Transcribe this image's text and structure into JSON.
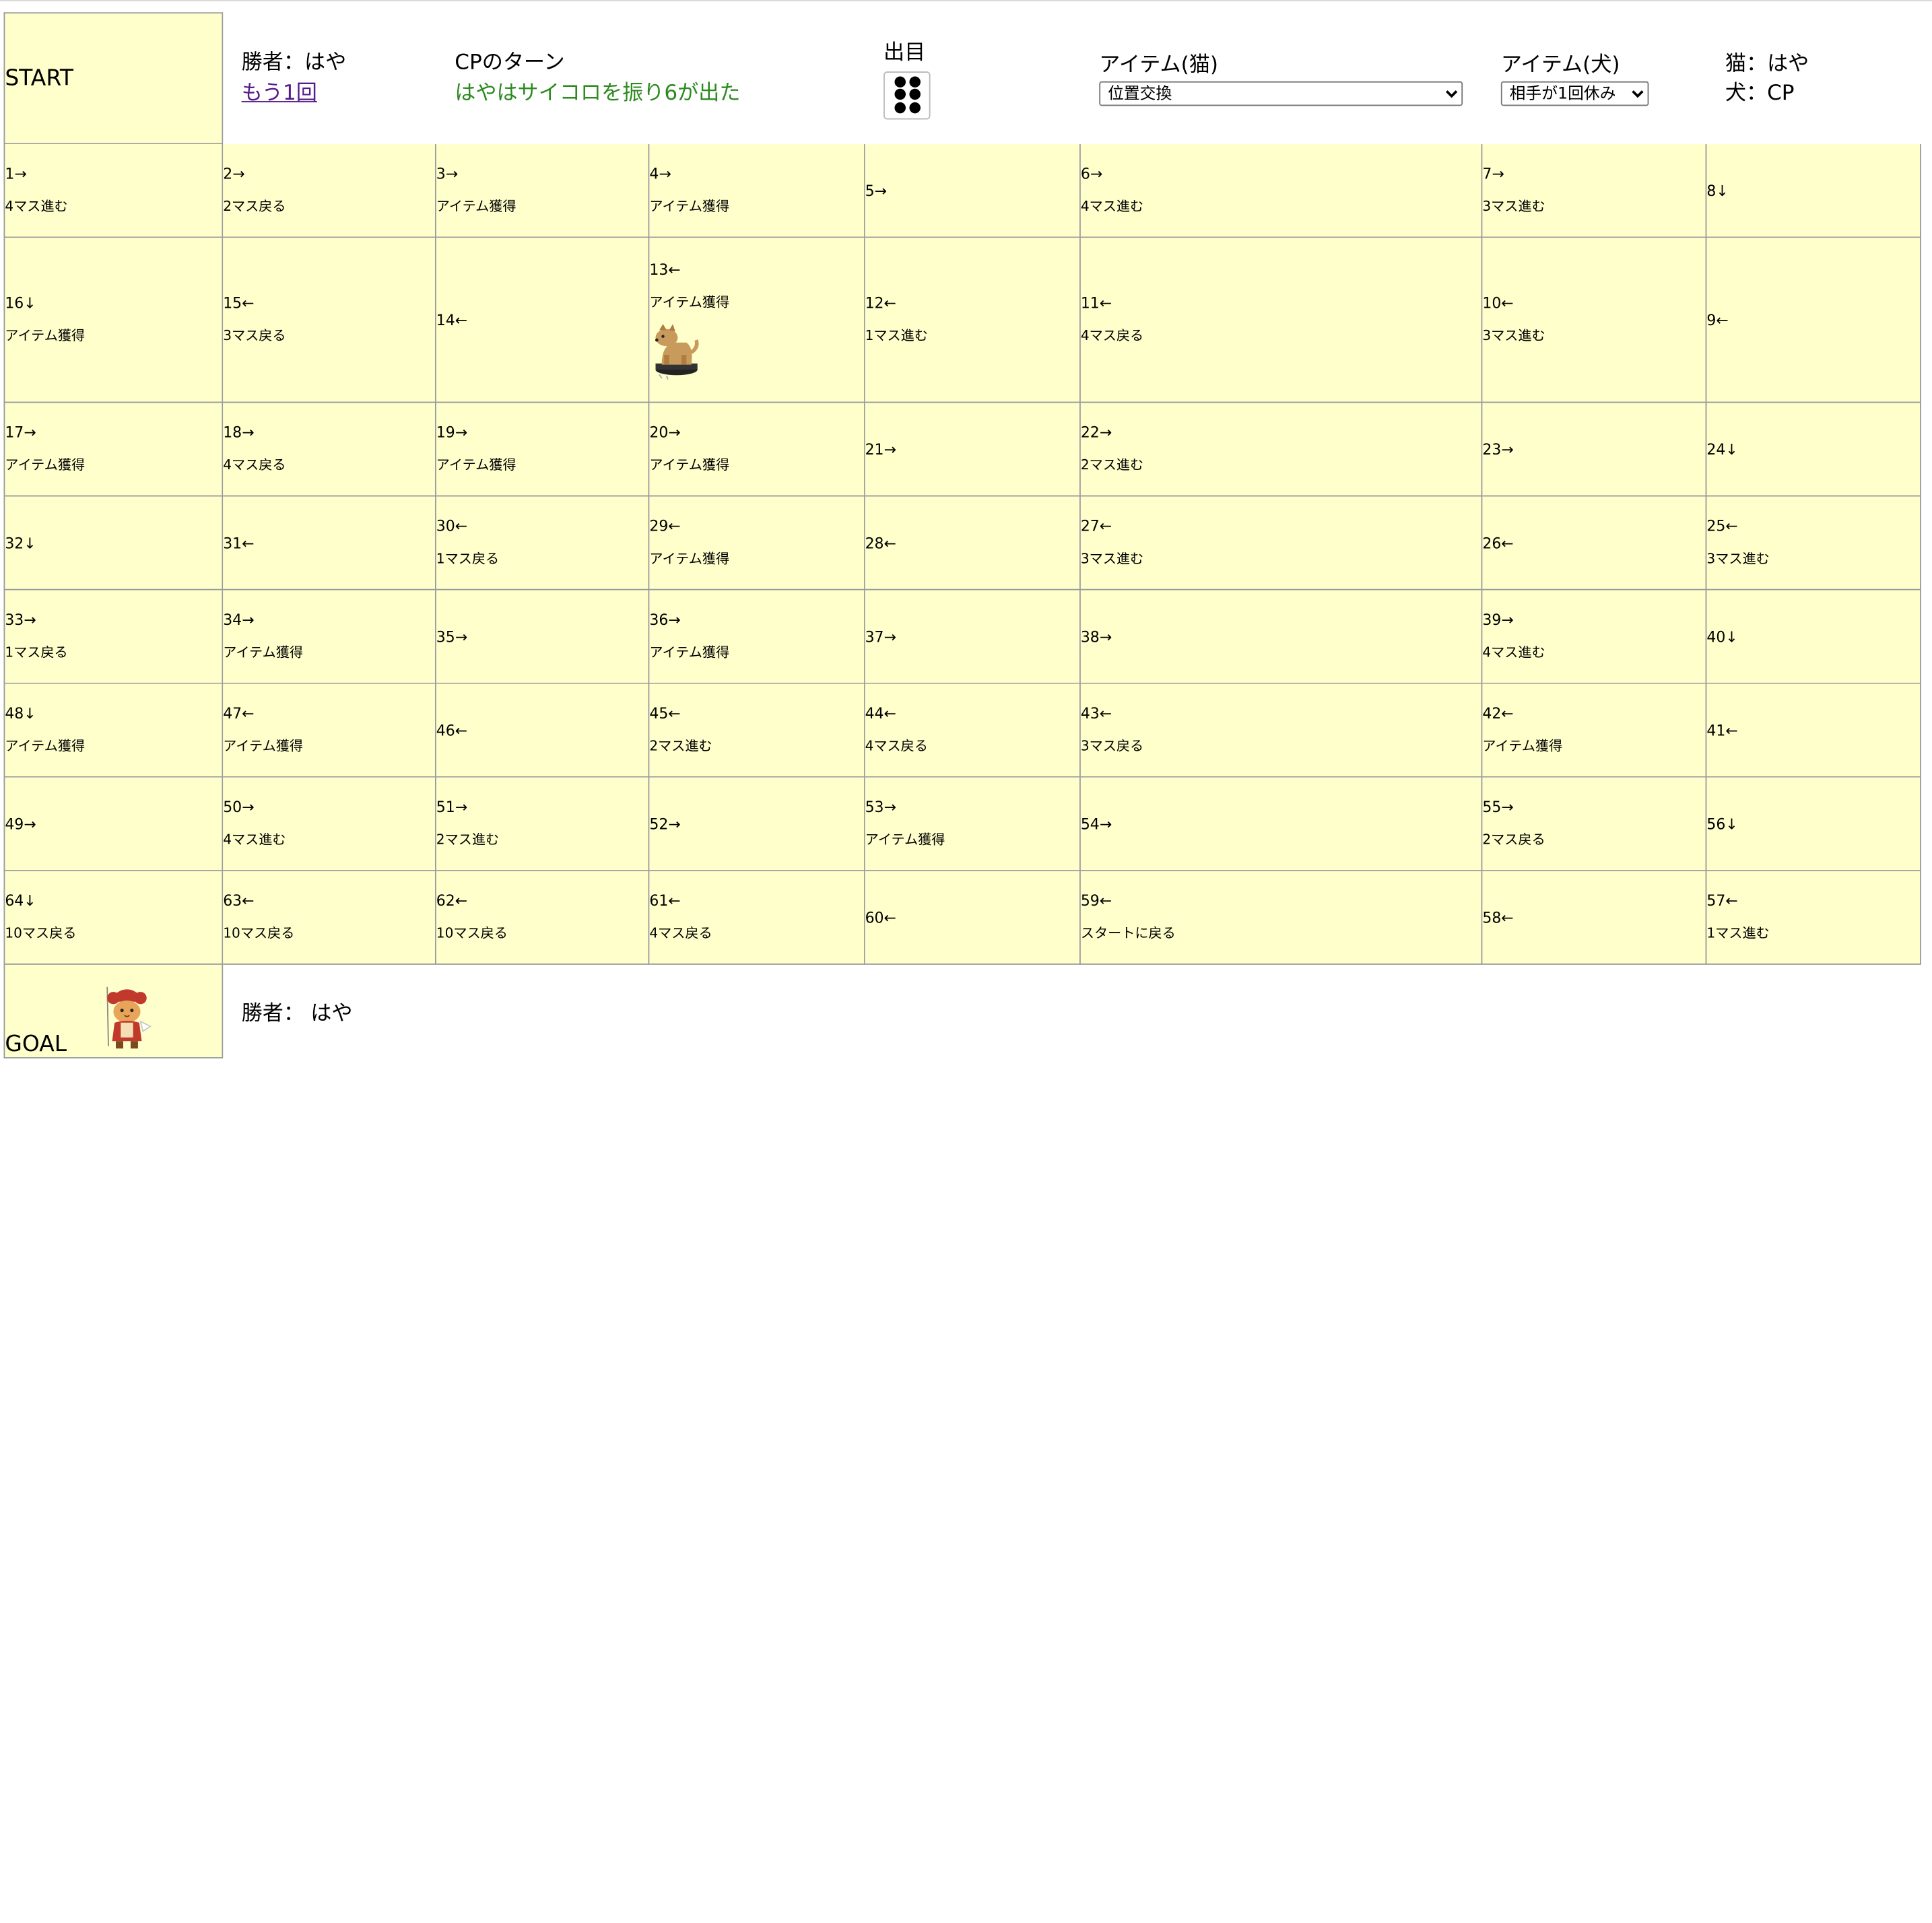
{
  "header": {
    "start_label": "START",
    "winner_prefix": "勝者：",
    "winner_name": "はや",
    "again_link": "もう1回",
    "turn_title": "CPのターン",
    "turn_message": "はやはサイコロを振り6が出た",
    "dice_title": "出目",
    "dice_value": 6,
    "cat_item_title": "アイテム(猫)",
    "cat_item_selected": "位置交換",
    "dog_item_title": "アイテム(犬)",
    "dog_item_selected": "相手が1回休み",
    "player_cat": "猫：はや",
    "player_dog": "犬：CP"
  },
  "board": {
    "rows": [
      [
        {
          "num": "1→",
          "action": "4マス進む"
        },
        {
          "num": "2→",
          "action": "2マス戻る"
        },
        {
          "num": "3→",
          "action": "アイテム獲得"
        },
        {
          "num": "4→",
          "action": "アイテム獲得"
        },
        {
          "num": "5→",
          "action": ""
        },
        {
          "num": "6→",
          "action": "4マス進む"
        },
        {
          "num": "7→",
          "action": "3マス進む"
        },
        {
          "num": "8↓",
          "action": ""
        }
      ],
      [
        {
          "num": "16↓",
          "action": "アイテム獲得"
        },
        {
          "num": "15←",
          "action": "3マス戻る"
        },
        {
          "num": "14←",
          "action": ""
        },
        {
          "num": "13←",
          "action": "アイテム獲得"
        },
        {
          "num": "12←",
          "action": "1マス進む"
        },
        {
          "num": "11←",
          "action": "4マス戻る"
        },
        {
          "num": "10←",
          "action": "3マス進む"
        },
        {
          "num": "9←",
          "action": ""
        }
      ],
      [
        {
          "num": "17→",
          "action": "アイテム獲得"
        },
        {
          "num": "18→",
          "action": "4マス戻る"
        },
        {
          "num": "19→",
          "action": "アイテム獲得"
        },
        {
          "num": "20→",
          "action": "アイテム獲得"
        },
        {
          "num": "21→",
          "action": ""
        },
        {
          "num": "22→",
          "action": "2マス進む"
        },
        {
          "num": "23→",
          "action": ""
        },
        {
          "num": "24↓",
          "action": ""
        }
      ],
      [
        {
          "num": "32↓",
          "action": ""
        },
        {
          "num": "31←",
          "action": ""
        },
        {
          "num": "30←",
          "action": "1マス戻る"
        },
        {
          "num": "29←",
          "action": "アイテム獲得"
        },
        {
          "num": "28←",
          "action": ""
        },
        {
          "num": "27←",
          "action": "3マス進む"
        },
        {
          "num": "26←",
          "action": ""
        },
        {
          "num": "25←",
          "action": "3マス進む"
        }
      ],
      [
        {
          "num": "33→",
          "action": "1マス戻る"
        },
        {
          "num": "34→",
          "action": "アイテム獲得"
        },
        {
          "num": "35→",
          "action": ""
        },
        {
          "num": "36→",
          "action": "アイテム獲得"
        },
        {
          "num": "37→",
          "action": ""
        },
        {
          "num": "38→",
          "action": ""
        },
        {
          "num": "39→",
          "action": "4マス進む"
        },
        {
          "num": "40↓",
          "action": ""
        }
      ],
      [
        {
          "num": "48↓",
          "action": "アイテム獲得"
        },
        {
          "num": "47←",
          "action": "アイテム獲得"
        },
        {
          "num": "46←",
          "action": ""
        },
        {
          "num": "45←",
          "action": "2マス進む"
        },
        {
          "num": "44←",
          "action": "4マス戻る"
        },
        {
          "num": "43←",
          "action": "3マス戻る"
        },
        {
          "num": "42←",
          "action": "アイテム獲得"
        },
        {
          "num": "41←",
          "action": ""
        }
      ],
      [
        {
          "num": "49→",
          "action": ""
        },
        {
          "num": "50→",
          "action": "4マス進む"
        },
        {
          "num": "51→",
          "action": "2マス進む"
        },
        {
          "num": "52→",
          "action": ""
        },
        {
          "num": "53→",
          "action": "アイテム獲得"
        },
        {
          "num": "54→",
          "action": ""
        },
        {
          "num": "55→",
          "action": "2マス戻る"
        },
        {
          "num": "56↓",
          "action": ""
        }
      ],
      [
        {
          "num": "64↓",
          "action": "10マス戻る"
        },
        {
          "num": "63←",
          "action": "10マス戻る"
        },
        {
          "num": "62←",
          "action": "10マス戻る"
        },
        {
          "num": "61←",
          "action": "4マス戻る"
        },
        {
          "num": "60←",
          "action": ""
        },
        {
          "num": "59←",
          "action": "スタートに戻る"
        },
        {
          "num": "58←",
          "action": ""
        },
        {
          "num": "57←",
          "action": "1マス進む"
        }
      ]
    ]
  },
  "pieces": {
    "dog_square": "13",
    "cat_square": "GOAL"
  },
  "footer": {
    "goal_label": "GOAL",
    "winner_prefix": "勝者：",
    "winner_name": "はや"
  }
}
